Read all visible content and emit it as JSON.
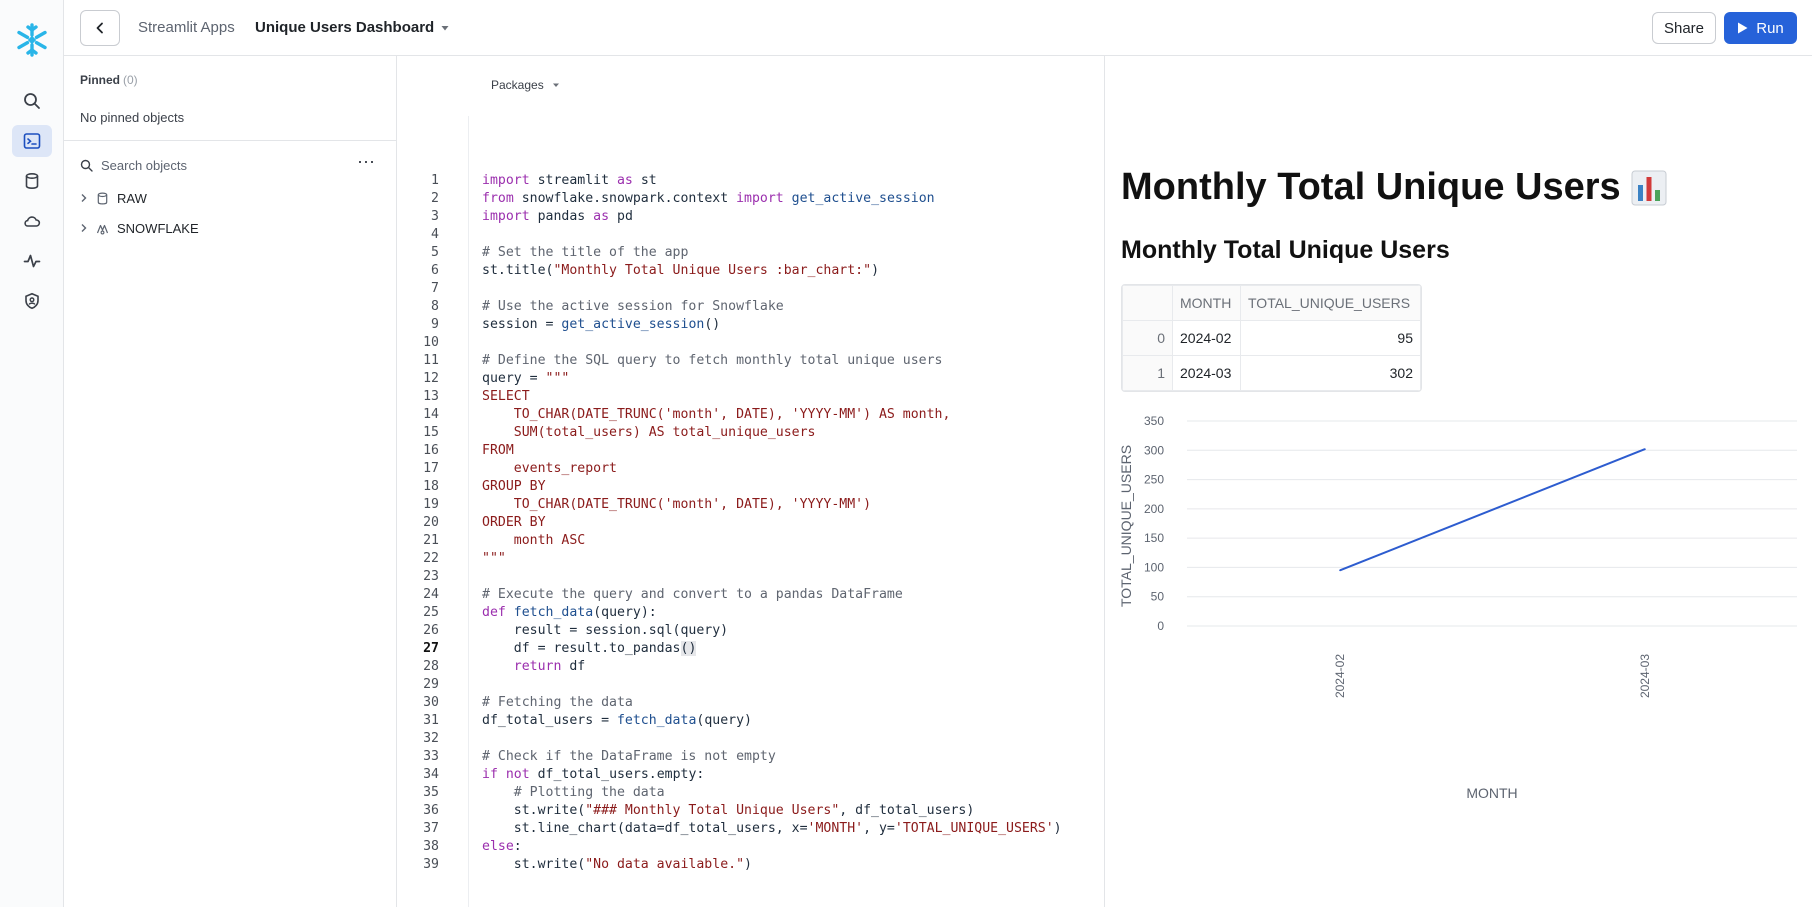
{
  "topbar": {
    "breadcrumb": "Streamlit Apps",
    "app_title": "Unique Users Dashboard",
    "share_label": "Share",
    "run_label": "Run"
  },
  "rail": {
    "items": [
      "search-icon",
      "code-icon",
      "database-icon",
      "cloud-icon",
      "activity-icon",
      "shield-icon"
    ],
    "active": "code-icon",
    "accent": "#29b5e8"
  },
  "browser": {
    "pinned_label": "Pinned",
    "pinned_count": "(0)",
    "no_pinned": "No pinned objects",
    "search_placeholder": "Search objects",
    "tree": [
      {
        "label": "RAW",
        "icon": "database-icon"
      },
      {
        "label": "SNOWFLAKE",
        "icon": "snowflake-db-icon"
      }
    ]
  },
  "editor": {
    "packages_label": "Packages",
    "current_line": 27,
    "lines": [
      "import streamlit as st",
      "from snowflake.snowpark.context import get_active_session",
      "import pandas as pd",
      "",
      "# Set the title of the app",
      "st.title(\"Monthly Total Unique Users :bar_chart:\")",
      "",
      "# Use the active session for Snowflake",
      "session = get_active_session()",
      "",
      "# Define the SQL query to fetch monthly total unique users",
      "query = \"\"\"",
      "SELECT",
      "    TO_CHAR(DATE_TRUNC('month', DATE), 'YYYY-MM') AS month,",
      "    SUM(total_users) AS total_unique_users",
      "FROM",
      "    events_report",
      "GROUP BY",
      "    TO_CHAR(DATE_TRUNC('month', DATE), 'YYYY-MM')",
      "ORDER BY",
      "    month ASC",
      "\"\"\"",
      "",
      "# Execute the query and convert to a pandas DataFrame",
      "def fetch_data(query):",
      "    result = session.sql(query)",
      "    df = result.to_pandas()",
      "    return df",
      "",
      "# Fetching the data",
      "df_total_users = fetch_data(query)",
      "",
      "# Check if the DataFrame is not empty",
      "if not df_total_users.empty:",
      "    # Plotting the data",
      "    st.write(\"### Monthly Total Unique Users\", df_total_users)",
      "    st.line_chart(data=df_total_users, x='MONTH', y='TOTAL_UNIQUE_USERS')",
      "else:",
      "    st.write(\"No data available.\")"
    ]
  },
  "preview": {
    "title": "Monthly Total Unique Users",
    "title_emoji": "bar-chart-emoji",
    "subtitle": "Monthly Total Unique Users",
    "table": {
      "columns": [
        "",
        "MONTH",
        "TOTAL_UNIQUE_USERS"
      ],
      "rows": [
        {
          "index": "0",
          "month": "2024-02",
          "total": "95"
        },
        {
          "index": "1",
          "month": "2024-03",
          "total": "302"
        }
      ]
    }
  },
  "chart_data": {
    "type": "line",
    "x": [
      "2024-02",
      "2024-03"
    ],
    "series": [
      {
        "values": [
          95,
          302
        ]
      }
    ],
    "xlabel": "MONTH",
    "ylabel": "TOTAL_UNIQUE_USERS",
    "yticks": [
      0,
      50,
      100,
      150,
      200,
      250,
      300,
      350
    ],
    "ylim": [
      0,
      350
    ],
    "grid": true,
    "line_color": "#2d5ccf"
  }
}
